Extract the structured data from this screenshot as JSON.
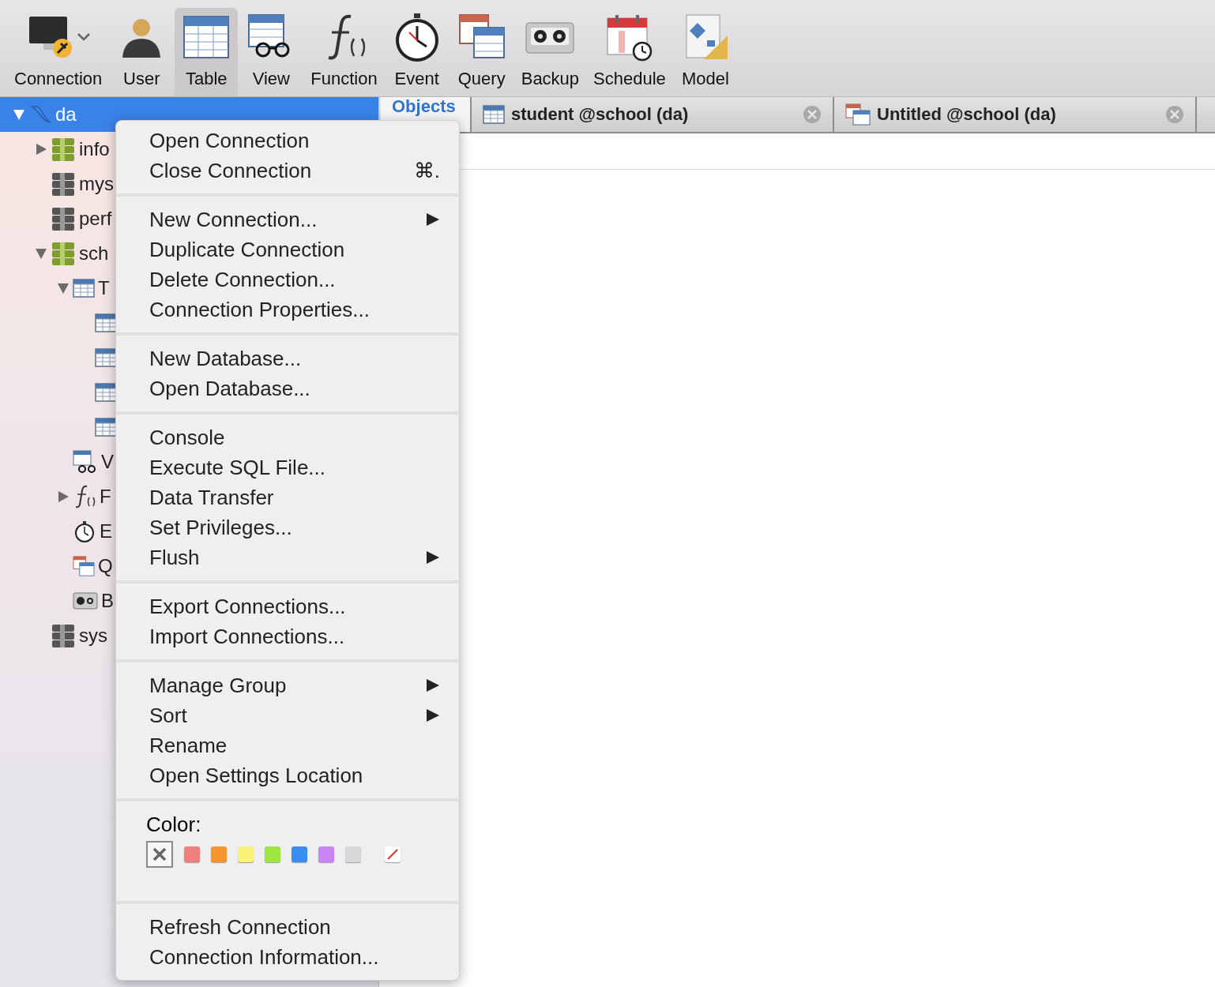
{
  "toolbar": {
    "items": [
      {
        "label": "Connection",
        "selected": false,
        "dropdown": true
      },
      {
        "label": "User",
        "selected": false
      },
      {
        "label": "Table",
        "selected": true
      },
      {
        "label": "View",
        "selected": false
      },
      {
        "label": "Function",
        "selected": false
      },
      {
        "label": "Event",
        "selected": false
      },
      {
        "label": "Query",
        "selected": false
      },
      {
        "label": "Backup",
        "selected": false
      },
      {
        "label": "Schedule",
        "selected": false
      },
      {
        "label": "Model",
        "selected": false
      }
    ]
  },
  "sidebar": {
    "tree": [
      {
        "kind": "connection",
        "label": "da",
        "selected": true,
        "expanded": true,
        "children": [
          {
            "kind": "database",
            "label": "info",
            "open": true,
            "expanded": false
          },
          {
            "kind": "database",
            "label": "mys",
            "open": false
          },
          {
            "kind": "database",
            "label": "perf",
            "open": false
          },
          {
            "kind": "database",
            "label": "sch",
            "open": true,
            "expanded": true,
            "children": [
              {
                "kind": "tables",
                "label": "T",
                "expanded": true,
                "children": [
                  {
                    "kind": "table"
                  },
                  {
                    "kind": "table"
                  },
                  {
                    "kind": "table"
                  },
                  {
                    "kind": "table"
                  }
                ]
              },
              {
                "kind": "views",
                "label": "V"
              },
              {
                "kind": "functions",
                "label": "F",
                "expanded": false
              },
              {
                "kind": "events",
                "label": "E"
              },
              {
                "kind": "queries",
                "label": "Q"
              },
              {
                "kind": "backups",
                "label": "B"
              }
            ]
          },
          {
            "kind": "database",
            "label": "sys",
            "open": false
          }
        ]
      }
    ]
  },
  "tabs": [
    {
      "kind": "objects",
      "label": "Objects",
      "selected": true
    },
    {
      "kind": "table",
      "label": "student @school (da)",
      "selected": false
    },
    {
      "kind": "query",
      "label": "Untitled @school (da)",
      "selected": false
    }
  ],
  "context_menu": {
    "sections": [
      {
        "items": [
          {
            "label": "Open Connection"
          },
          {
            "label": "Close Connection",
            "shortcut": "⌘."
          }
        ]
      },
      {
        "items": [
          {
            "label": "New Connection...",
            "submenu": true
          },
          {
            "label": "Duplicate Connection"
          },
          {
            "label": "Delete Connection..."
          },
          {
            "label": "Connection Properties..."
          }
        ]
      },
      {
        "items": [
          {
            "label": "New Database..."
          },
          {
            "label": "Open Database..."
          }
        ]
      },
      {
        "items": [
          {
            "label": "Console"
          },
          {
            "label": "Execute SQL File..."
          },
          {
            "label": "Data Transfer"
          },
          {
            "label": "Set Privileges..."
          },
          {
            "label": "Flush",
            "submenu": true
          }
        ]
      },
      {
        "items": [
          {
            "label": "Export Connections..."
          },
          {
            "label": "Import Connections..."
          }
        ]
      },
      {
        "items": [
          {
            "label": "Manage Group",
            "submenu": true
          },
          {
            "label": "Sort",
            "submenu": true
          },
          {
            "label": "Rename"
          },
          {
            "label": "Open Settings Location"
          }
        ]
      },
      {
        "color_label": "Color:",
        "swatches": [
          {
            "kind": "none",
            "selected": true
          },
          {
            "kind": "color",
            "color": "#f07f7f",
            "selected": false
          },
          {
            "kind": "color",
            "color": "#f7952f",
            "selected": false
          },
          {
            "kind": "color",
            "color": "#fbf27a",
            "selected": false
          },
          {
            "kind": "color",
            "color": "#9ee63f",
            "selected": false
          },
          {
            "kind": "color",
            "color": "#3a8ef0",
            "selected": false
          },
          {
            "kind": "color",
            "color": "#c884f2",
            "selected": false
          },
          {
            "kind": "color",
            "color": "#d8d8d8",
            "selected": false
          },
          {
            "kind": "custom",
            "selected": false
          }
        ]
      },
      {
        "items": [
          {
            "label": "Refresh Connection"
          },
          {
            "label": "Connection Information..."
          }
        ]
      }
    ]
  }
}
